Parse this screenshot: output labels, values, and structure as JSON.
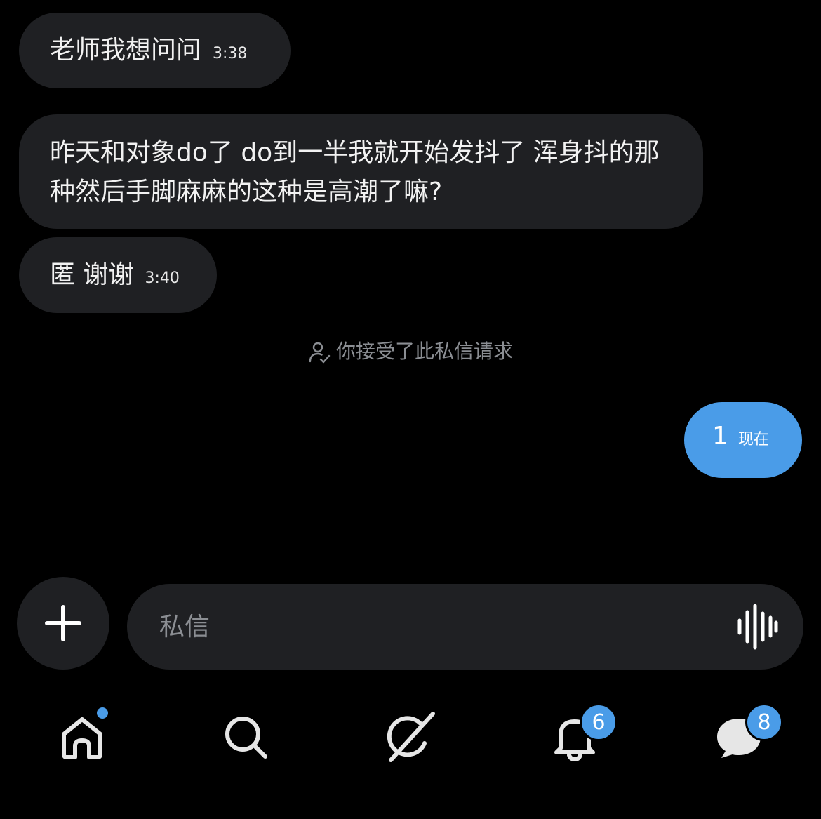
{
  "messages": [
    {
      "text": "老师我想问问",
      "time": "3:38",
      "direction": "incoming"
    },
    {
      "text": "昨天和对象do了 do到一半我就开始发抖了 浑身抖的那种然后手脚麻麻的这种是高潮了嘛?",
      "direction": "incoming"
    },
    {
      "text": "匿 谢谢",
      "time": "3:40",
      "direction": "incoming"
    },
    {
      "text": "1",
      "time": "现在",
      "direction": "outgoing"
    }
  ],
  "system_note": {
    "icon": "person-check-icon",
    "text": "你接受了此私信请求"
  },
  "composer": {
    "placeholder": "私信",
    "value": "",
    "add_icon": "plus-icon",
    "voice_icon": "waveform-icon"
  },
  "bottom_nav": {
    "home": {
      "icon": "home-icon",
      "has_dot": true
    },
    "search": {
      "icon": "search-icon"
    },
    "grok": {
      "icon": "grok-icon"
    },
    "notifications": {
      "icon": "bell-icon",
      "badge": "6"
    },
    "messages": {
      "icon": "message-icon",
      "badge": "8"
    }
  },
  "colors": {
    "background": "#000000",
    "bubble_incoming": "#1f2023",
    "bubble_outgoing": "#4a9ce8",
    "accent": "#4a9ce8",
    "muted_text": "#8b8e93"
  }
}
